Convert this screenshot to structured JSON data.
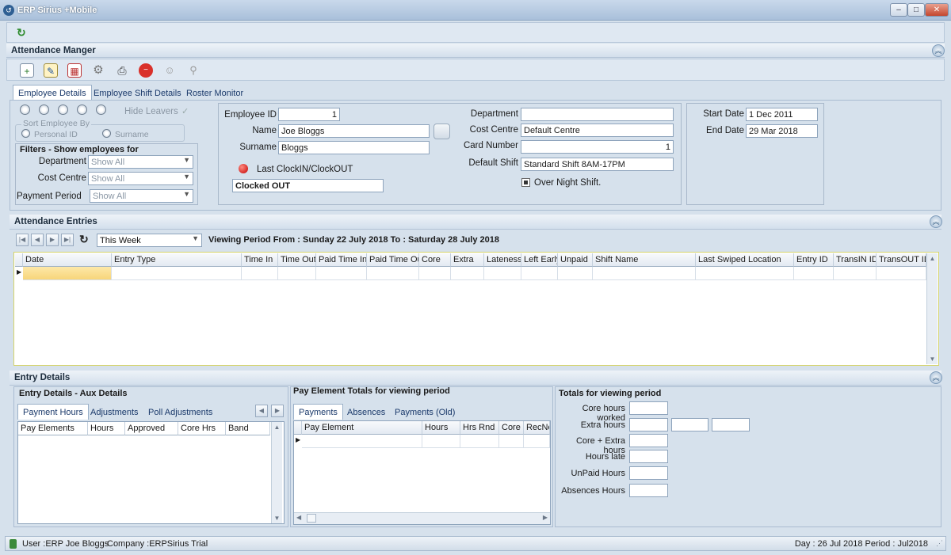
{
  "window": {
    "title": "ERP Sirius +Mobile"
  },
  "attendance_manager": {
    "header": "Attendance Manger"
  },
  "tabs": [
    "Employee Details",
    "Employee Shift Details",
    "Roster Monitor"
  ],
  "left_filter": {
    "hide_leavers": "Hide Leavers",
    "sort_group": "Sort Employee By",
    "sort_personal": "Personal ID",
    "sort_surname": "Surname",
    "filters_title": "Filters - Show employees for",
    "department_label": "Department",
    "department_value": "Show All",
    "cost_centre_label": "Cost Centre",
    "cost_centre_value": "Show All",
    "payment_period_label": "Payment Period",
    "payment_period_value": "Show All"
  },
  "employee": {
    "id_label": "Employee ID",
    "id_value": "1",
    "name_label": "Name",
    "name_value": "Joe Bloggs",
    "surname_label": "Surname",
    "surname_value": "Bloggs",
    "last_clock_label": "Last ClockIN/ClockOUT",
    "clock_status": "Clocked OUT",
    "department_label": "Department",
    "department_value": "",
    "cost_centre_label": "Cost Centre",
    "cost_centre_value": "Default Centre",
    "card_number_label": "Card Number",
    "card_number_value": "1",
    "default_shift_label": "Default Shift",
    "default_shift_value": "Standard Shift 8AM-17PM",
    "overnight_label": "Over Night Shift.",
    "start_date_label": "Start Date",
    "start_date_value": "1 Dec 2011",
    "end_date_label": "End Date",
    "end_date_value": "29 Mar 2018"
  },
  "attendance_entries": {
    "header": "Attendance Entries",
    "period_select": "This Week",
    "viewing_period": "Viewing Period From : Sunday 22 July 2018 To : Saturday 28 July 2018",
    "columns": [
      "Date",
      "Entry Type",
      "Time In",
      "Time Out",
      "Paid Time In",
      "Paid Time Out",
      "Core",
      "Extra",
      "Lateness",
      "Left Early",
      "Unpaid",
      "Shift Name",
      "Last Swiped Location",
      "Entry ID",
      "TransIN ID",
      "TransOUT ID"
    ]
  },
  "entry_details": {
    "header": "Entry Details",
    "aux_title": "Entry Details - Aux Details",
    "aux_tabs": [
      "Payment Hours",
      "Adjustments",
      "Poll Adjustments"
    ],
    "aux_columns": [
      "Pay Elements",
      "Hours",
      "Approved",
      "Core Hrs",
      "Band"
    ],
    "pay_title": "Pay Element Totals for viewing period",
    "pay_tabs": [
      "Payments",
      "Absences",
      "Payments (Old)"
    ],
    "pay_columns": [
      "Pay Element",
      "Hours",
      "Hrs Rnd",
      "Core",
      "RecNo"
    ],
    "totals_title": "Totals for viewing period",
    "totals_labels": [
      "Core hours worked",
      "Extra hours",
      "Core + Extra hours",
      "Hours late",
      "UnPaid Hours",
      "Absences Hours"
    ]
  },
  "status_bar": {
    "user": "User :ERP Joe Bloggs",
    "company": "Company :ERPSirius Trial",
    "day_period": "Day : 26 Jul 2018  Period : Jul2018"
  },
  "icons": [
    "app-icon",
    "refresh-icon",
    "new-icon",
    "edit-icon",
    "calendar-icon",
    "settings-icon",
    "print-icon",
    "delete-icon",
    "user-icon",
    "find-user-icon"
  ]
}
